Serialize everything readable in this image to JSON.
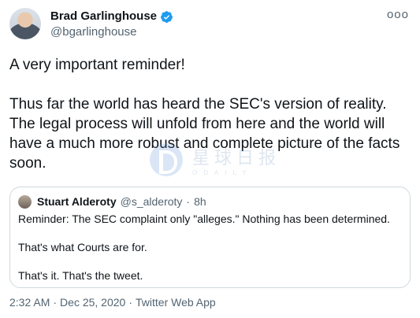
{
  "author": {
    "name": "Brad Garlinghouse",
    "handle": "@bgarlinghouse",
    "verified_icon": "verified-badge-icon"
  },
  "more_label": "ooo",
  "tweet": {
    "paragraphs": [
      "A very important reminder!",
      "Thus far the world has heard the SEC's version of reality. The legal process will unfold from here and the world will have a much more robust and complete picture of the facts soon."
    ]
  },
  "watermark": {
    "cn": "星球日报",
    "en": "ODAILY"
  },
  "quote": {
    "name": "Stuart Alderoty",
    "handle": "@s_alderoty",
    "separator": "·",
    "time": "8h",
    "paragraphs": [
      "Reminder: The SEC complaint only \"alleges.\" Nothing has been determined.",
      "That's what Courts are for.",
      "That's it. That's the tweet."
    ]
  },
  "meta": {
    "time": "2:32 AM",
    "sep1": "·",
    "date": "Dec 25, 2020",
    "sep2": "·",
    "source": "Twitter Web App"
  },
  "colors": {
    "text": "#0f1419",
    "secondary": "#536471",
    "verified": "#1d9bf0",
    "border": "#cfd9de"
  }
}
